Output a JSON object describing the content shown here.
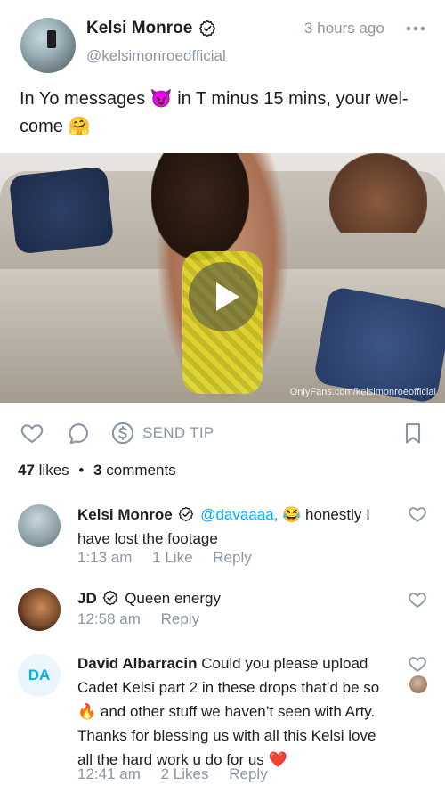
{
  "post": {
    "author_name": "Kelsi Monroe",
    "handle": "@kelsimonroeofficial",
    "time_ago": "3 hours ago",
    "caption": "In Yo messages 😈 in T minus 15 mins, your wel-come 🤗",
    "watermark": "OnlyFans.com/kelsimonroeofficial"
  },
  "actions": {
    "send_tip_label": "SEND TIP"
  },
  "stats": {
    "likes_count": "47",
    "likes_label": "likes",
    "separator": "•",
    "comments_count": "3",
    "comments_label": "comments"
  },
  "comments": [
    {
      "name": "Kelsi Monroe",
      "mention": "@davaaaa,",
      "text": " 😂 honestly I have lost the footage",
      "time": "1:13 am",
      "likes": "1 Like",
      "reply": "Reply"
    },
    {
      "name": "JD",
      "text": " Queen energy",
      "time": "12:58 am",
      "reply": "Reply"
    },
    {
      "initials": "DA",
      "name": "David Albarracin",
      "text": " Could you please upload Cadet Kelsi part 2 in these drops that’d be so 🔥 and other stuff we haven’t seen with Arty. Thanks for blessing us with all this Kelsi love all the hard work u do for us ❤️",
      "time": "12:41 am",
      "likes": "2 Likes",
      "reply": "Reply"
    }
  ],
  "colors": {
    "accent": "#00aff0",
    "muted": "#8a96a3",
    "text": "#1e1e1e"
  },
  "icons": [
    "verified-icon",
    "more-icon",
    "play-icon",
    "heart-icon",
    "comment-icon",
    "dollar-icon",
    "bookmark-icon"
  ]
}
